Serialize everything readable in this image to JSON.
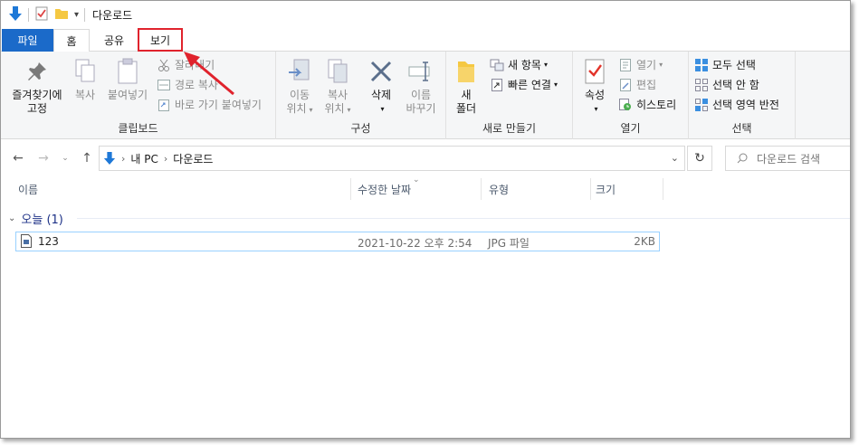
{
  "window": {
    "title": "다운로드"
  },
  "tabs": {
    "file": "파일",
    "home": "홈",
    "share": "공유",
    "view": "보기"
  },
  "ribbon": {
    "clipboard": {
      "label": "클립보드",
      "pin": "즐겨찾기에",
      "pin2": "고정",
      "copy": "복사",
      "paste": "붙여넣기",
      "cut": "잘라내기",
      "copy_path": "경로 복사",
      "paste_shortcut": "바로 가기 붙여넣기"
    },
    "organize": {
      "label": "구성",
      "move_to": "이동",
      "move_to2": "위치",
      "copy_to": "복사",
      "copy_to2": "위치",
      "delete": "삭제",
      "rename": "이름",
      "rename2": "바꾸기"
    },
    "new": {
      "label": "새로 만들기",
      "new_folder": "새",
      "new_folder2": "폴더",
      "new_item": "새 항목",
      "easy_access": "빠른 연결"
    },
    "open": {
      "label": "열기",
      "properties": "속성",
      "open": "열기",
      "edit": "편집",
      "history": "히스토리"
    },
    "select": {
      "label": "선택",
      "select_all": "모두 선택",
      "select_none": "선택 안 함",
      "invert": "선택 영역 반전"
    }
  },
  "address": {
    "crumbs": [
      "내 PC",
      "다운로드"
    ],
    "search_placeholder": "다운로드 검색"
  },
  "columns": {
    "name": "이름",
    "date": "수정한 날짜",
    "type": "유형",
    "size": "크기"
  },
  "group": {
    "label": "오늘 (1)"
  },
  "files": [
    {
      "name": "123",
      "date": "2021-10-22 오후 2:54",
      "type": "JPG 파일",
      "size": "2KB"
    }
  ],
  "colors": {
    "accent": "#1b6ac9",
    "annotation": "#e0232d",
    "group_text": "#1e3287"
  }
}
